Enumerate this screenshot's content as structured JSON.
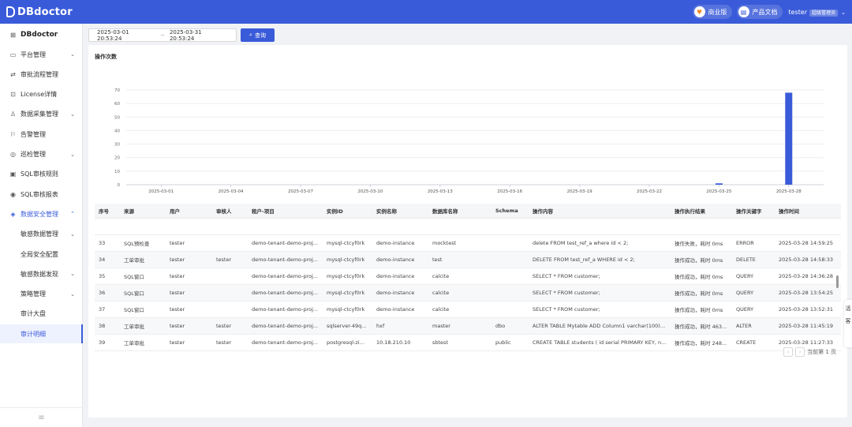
{
  "app": {
    "brand": "DBdoctor"
  },
  "topbar": {
    "business_label": "商业版",
    "docs_label": "产品文档",
    "user": "tester",
    "role_badge": "超级管理员"
  },
  "sidebar": {
    "brand": "DBdoctor",
    "items": [
      {
        "label": "平台管理",
        "icon": "monitor-icon",
        "arrow": true
      },
      {
        "label": "审批流程管理",
        "icon": "flow-icon",
        "arrow": false
      },
      {
        "label": "License详情",
        "icon": "license-icon",
        "arrow": false
      },
      {
        "label": "数据采集管理",
        "icon": "user-icon",
        "arrow": true
      },
      {
        "label": "告警管理",
        "icon": "alarm-icon",
        "arrow": false
      },
      {
        "label": "巡检管理",
        "icon": "inspect-icon",
        "arrow": true
      },
      {
        "label": "SQL审核规则",
        "icon": "rule-icon",
        "arrow": false
      },
      {
        "label": "SQL审核报表",
        "icon": "report-icon",
        "arrow": false
      },
      {
        "label": "数据安全管理",
        "icon": "security-icon",
        "arrow": true
      }
    ],
    "subitems": [
      {
        "label": "敏感数据管理",
        "arrow": true
      },
      {
        "label": "全局安全配置",
        "arrow": false
      },
      {
        "label": "敏感数据发现",
        "arrow": true
      },
      {
        "label": "策略管理",
        "arrow": true
      },
      {
        "label": "审计大盘",
        "arrow": false
      },
      {
        "label": "审计明细",
        "arrow": false
      }
    ]
  },
  "filter": {
    "start": "2025-03-01 20:53:24",
    "end": "2025-03-31 20:53:24",
    "separator": "~",
    "search_label": "查询"
  },
  "chart_data": {
    "type": "bar",
    "title": "操作次数",
    "x_tick_labels": [
      "2025-03-01",
      "2025-03-04",
      "2025-03-07",
      "2025-03-10",
      "2025-03-13",
      "2025-03-16",
      "2025-03-19",
      "2025-03-22",
      "2025-03-25",
      "2025-03-28"
    ],
    "categories": [
      "2025-03-25",
      "2025-03-28"
    ],
    "values": [
      1,
      68
    ],
    "ylim": [
      0,
      70
    ],
    "yticks": [
      0,
      10,
      20,
      30,
      40,
      50,
      60,
      70
    ],
    "grid": true,
    "bar_color": "#3a5bd9"
  },
  "table": {
    "columns": [
      "序号",
      "来源",
      "用户",
      "审核人",
      "租户-项目",
      "实例ID",
      "实例名称",
      "数据库名称",
      "Schema",
      "操作内容",
      "操作执行结果",
      "操作关键字",
      "操作时间"
    ],
    "rows": [
      [
        "33",
        "SQL预检查",
        "tester",
        "",
        "demo-tenant-demo-proj...",
        "mysql-ctcyf0rk",
        "demo-instance",
        "mocktest",
        "",
        "delete FROM test_ref_a where id < 2;",
        "操作失败，耗时 0ms",
        "ERROR",
        "2025-03-28 14:59:25"
      ],
      [
        "34",
        "工单审批",
        "tester",
        "tester",
        "demo-tenant-demo-proj...",
        "mysql-ctcyf0rk",
        "demo-instance",
        "test",
        "",
        "DELETE FROM test_ref_a WHERE id < 2;",
        "操作成功，耗时 0ms",
        "DELETE",
        "2025-03-28 14:58:33"
      ],
      [
        "35",
        "SQL窗口",
        "tester",
        "",
        "demo-tenant-demo-proj...",
        "mysql-ctcyf0rk",
        "demo-instance",
        "calcite",
        "",
        "SELECT * FROM customer;",
        "操作成功，耗时 0ms",
        "QUERY",
        "2025-03-28 14:36:28"
      ],
      [
        "36",
        "SQL窗口",
        "tester",
        "",
        "demo-tenant-demo-proj...",
        "mysql-ctcyf0rk",
        "demo-instance",
        "calcite",
        "",
        "SELECT * FROM customer;",
        "操作成功，耗时 0ms",
        "QUERY",
        "2025-03-28 13:54:25"
      ],
      [
        "37",
        "SQL窗口",
        "tester",
        "",
        "demo-tenant-demo-proj...",
        "mysql-ctcyf0rk",
        "demo-instance",
        "calcite",
        "",
        "SELECT * FROM customer;",
        "操作成功，耗时 0ms",
        "QUERY",
        "2025-03-28 13:52:31"
      ],
      [
        "38",
        "工单审批",
        "tester",
        "tester",
        "demo-tenant-demo-proj...",
        "sqlserver-49q2...",
        "hxf",
        "master",
        "dbo",
        "ALTER TABLE Mytable ADD Column1 varchar(100) DEF...",
        "操作成功，耗时 463...",
        "ALTER",
        "2025-03-28 11:45:19"
      ],
      [
        "39",
        "工单审批",
        "tester",
        "tester",
        "demo-tenant-demo-proj...",
        "postgresql-zim...",
        "10.18.210.10",
        "sbtest",
        "public",
        "CREATE TABLE students ( id serial PRIMARY KEY, name...",
        "操作成功，耗时 248...",
        "CREATE",
        "2025-03-28 11:27:33"
      ]
    ]
  },
  "pager": {
    "text": "当前第 1 页"
  },
  "side_tools": {
    "t1": "活",
    "t2": "客"
  }
}
